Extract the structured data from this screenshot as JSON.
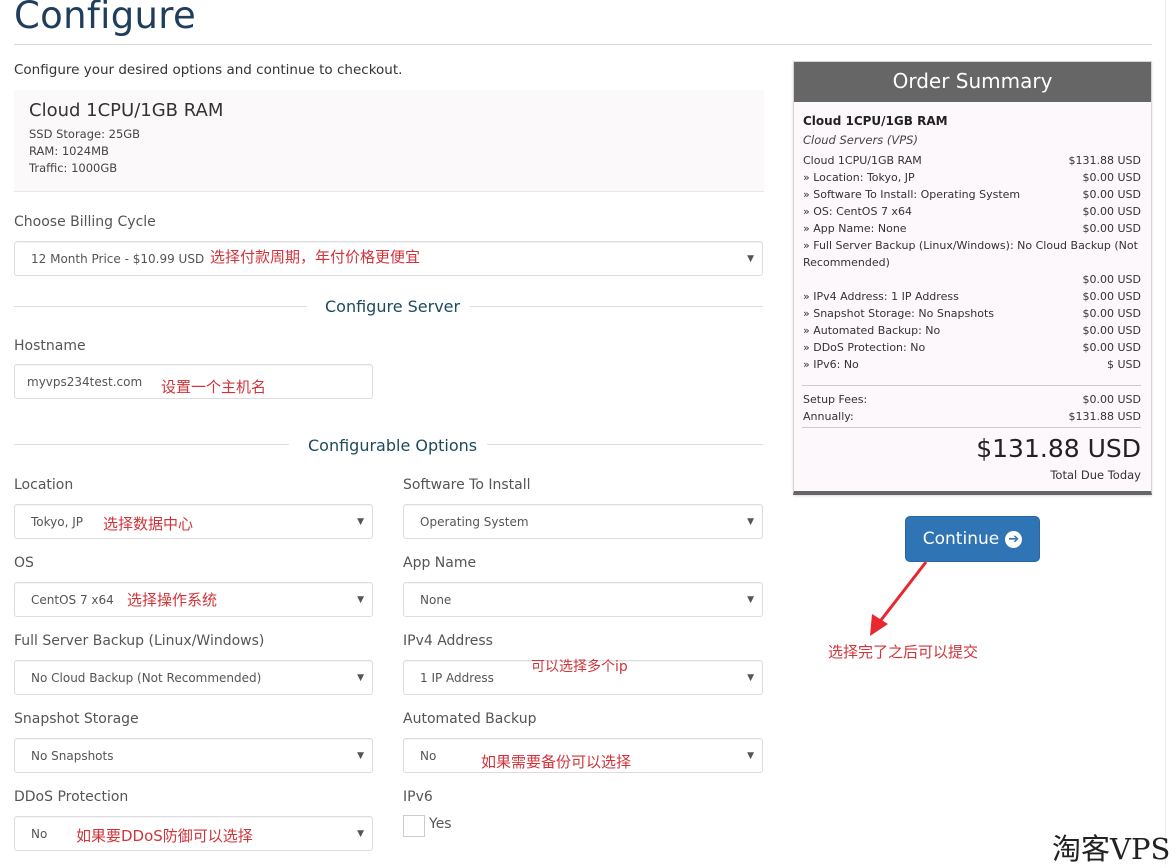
{
  "page": {
    "title": "Configure",
    "intro": "Configure your desired options and continue to checkout."
  },
  "product": {
    "name": "Cloud 1CPU/1GB RAM",
    "specs": [
      "SSD Storage: 25GB",
      "RAM: 1024MB",
      "Traffic: 1000GB"
    ]
  },
  "billing": {
    "label": "Choose Billing Cycle",
    "value": "12 Month Price - $10.99 USD",
    "note": "选择付款周期，年付价格更便宜"
  },
  "sections": {
    "configure_server": "Configure Server",
    "configurable_options": "Configurable Options"
  },
  "hostname": {
    "label": "Hostname",
    "value": "myvps234test.com",
    "note": "设置一个主机名"
  },
  "options": {
    "location": {
      "label": "Location",
      "value": "Tokyo, JP",
      "note": "选择数据中心"
    },
    "software": {
      "label": "Software To Install",
      "value": "Operating System"
    },
    "os": {
      "label": "OS",
      "value": "CentOS 7 x64",
      "note": "选择操作系统"
    },
    "app_name": {
      "label": "App Name",
      "value": "None"
    },
    "backup": {
      "label": "Full Server Backup (Linux/Windows)",
      "value": "No Cloud Backup (Not Recommended)"
    },
    "ipv4": {
      "label": "IPv4 Address",
      "value": "1 IP Address",
      "note": "可以选择多个ip"
    },
    "snapshot": {
      "label": "Snapshot Storage",
      "value": "No Snapshots"
    },
    "auto_backup": {
      "label": "Automated Backup",
      "value": "No",
      "note": "如果需要备份可以选择"
    },
    "ddos": {
      "label": "DDoS Protection",
      "value": "No",
      "note": "如果要DDoS防御可以选择"
    },
    "ipv6": {
      "label": "IPv6",
      "checkbox_label": "Yes",
      "checked": false
    }
  },
  "summary": {
    "heading": "Order Summary",
    "product_name": "Cloud 1CPU/1GB RAM",
    "product_group": "Cloud Servers (VPS)",
    "lines": [
      {
        "label": "Cloud 1CPU/1GB RAM",
        "amount": "$131.88 USD"
      },
      {
        "label": "» Location: Tokyo, JP",
        "amount": "$0.00 USD"
      },
      {
        "label": "» Software To Install: Operating System",
        "amount": "$0.00 USD"
      },
      {
        "label": "» OS: CentOS 7 x64",
        "amount": "$0.00 USD"
      },
      {
        "label": "» App Name: None",
        "amount": "$0.00 USD"
      },
      {
        "label": "» Full Server Backup (Linux/Windows): No Cloud Backup (Not",
        "amount": ""
      },
      {
        "label": "Recommended)",
        "amount": ""
      },
      {
        "label": "",
        "amount": "$0.00 USD"
      },
      {
        "label": "» IPv4 Address: 1 IP Address",
        "amount": "$0.00 USD"
      },
      {
        "label": "» Snapshot Storage: No Snapshots",
        "amount": "$0.00 USD"
      },
      {
        "label": "» Automated Backup: No",
        "amount": "$0.00 USD"
      },
      {
        "label": "» DDoS Protection: No",
        "amount": "$0.00 USD"
      },
      {
        "label": "» IPv6: No",
        "amount": "$ USD"
      }
    ],
    "setup_fees_label": "Setup Fees:",
    "setup_fees": "$0.00 USD",
    "recurring_label": "Annually:",
    "recurring": "$131.88 USD",
    "total": "$131.88 USD",
    "total_label": "Total Due Today"
  },
  "actions": {
    "continue_label": "Continue",
    "continue_note": "选择完了之后可以提交"
  },
  "watermark": "淘客VPS",
  "colors": {
    "title": "#1f3d5c",
    "button": "#2f74b5",
    "summary_header": "#666666",
    "annotation": "#d0343a"
  }
}
